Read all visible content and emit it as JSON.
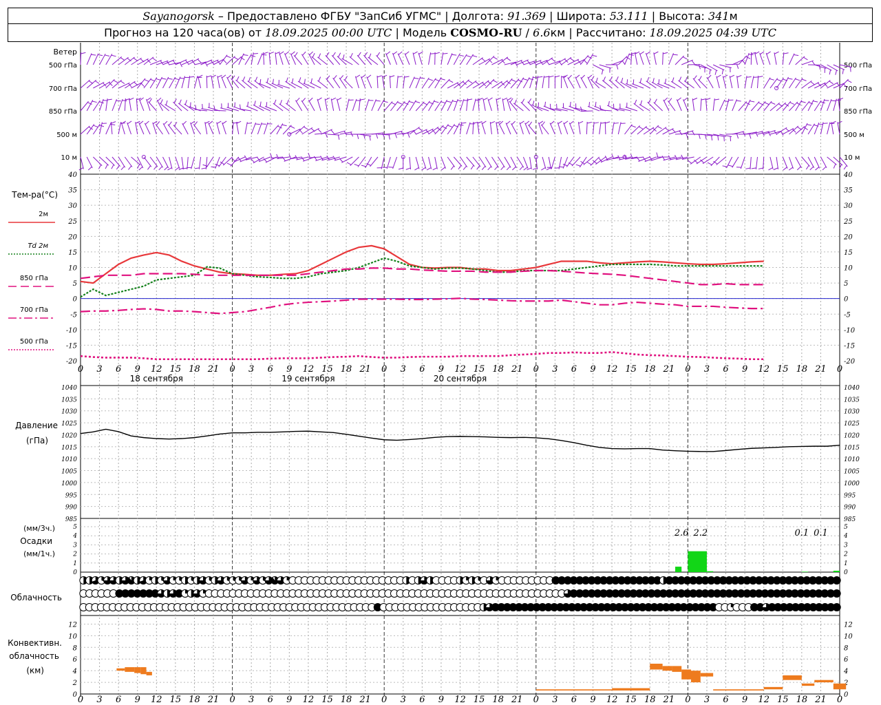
{
  "header": {
    "line1": [
      {
        "text": "Sayanogorsk",
        "style": "it"
      },
      {
        "text": " – Предоставлено ФГБУ \"ЗапСиб УГМС\" | Долгота: ",
        "style": ""
      },
      {
        "text": "91.369",
        "style": "it"
      },
      {
        "text": " | Широта: ",
        "style": ""
      },
      {
        "text": "53.111",
        "style": "it"
      },
      {
        "text": " | Высота: ",
        "style": ""
      },
      {
        "text": "341",
        "style": "it"
      },
      {
        "text": "м",
        "style": ""
      }
    ],
    "line2": [
      {
        "text": "Прогноз на 120 часа(ов) от ",
        "style": ""
      },
      {
        "text": "18.09.2025 00:00 UTC",
        "style": "it"
      },
      {
        "text": "  | Модель ",
        "style": ""
      },
      {
        "text": "COSMO-RU",
        "style": "bd"
      },
      {
        "text": " / ",
        "style": ""
      },
      {
        "text": "6.6",
        "style": "it"
      },
      {
        "text": "км | Рассчитано: ",
        "style": ""
      },
      {
        "text": "18.09.2025 04:39 UTC",
        "style": "it"
      }
    ]
  },
  "colors": {
    "t2m": "#e8373a",
    "td2m": "#13801a",
    "t850": "#e0107e",
    "t700": "#e0107e",
    "t500": "#e0107e",
    "wind": "#8a19c8",
    "pressure": "#000000",
    "precip": "#12d617",
    "convective": "#ee7b1e",
    "zeroline": "#2222cc"
  },
  "chart_data": [
    {
      "type": "barbs",
      "name": "wind",
      "panel_label": "Ветер",
      "levels": [
        "500 гПа",
        "700 гПа",
        "850 гПа",
        "500 м",
        "10 м"
      ],
      "x_hours": [
        0,
        120
      ],
      "time_step_h": 1
    },
    {
      "type": "line",
      "panel_label": "Тем-ра(°C)",
      "ylim": [
        -20,
        40
      ],
      "yticks": [
        -20,
        -15,
        -10,
        -5,
        0,
        5,
        10,
        15,
        20,
        25,
        30,
        35,
        40
      ],
      "legend": [
        {
          "label": "2м",
          "key": "t2m",
          "dash": "solid"
        },
        {
          "label": "Td  2м",
          "key": "td2m",
          "dash": "dot"
        },
        {
          "label": "850 гПа",
          "key": "t850",
          "dash": "long"
        },
        {
          "label": "700 гПа",
          "key": "t700",
          "dash": "dashdot"
        },
        {
          "label": "500 гПа",
          "key": "t500",
          "dash": "dot"
        }
      ],
      "x_hours": [
        0,
        2,
        4,
        6,
        8,
        10,
        12,
        14,
        16,
        18,
        20,
        22,
        24,
        26,
        28,
        30,
        32,
        34,
        36,
        38,
        40,
        42,
        44,
        46,
        48,
        50,
        52,
        54,
        56,
        58,
        60,
        62,
        64,
        66,
        68,
        70,
        72,
        74,
        76,
        78,
        80,
        82,
        84,
        86,
        88,
        90,
        92,
        94,
        96,
        98,
        100,
        102,
        104,
        106,
        108,
        110,
        112,
        114,
        116,
        118,
        120
      ],
      "series": [
        {
          "key": "t2m",
          "values": [
            5.5,
            5,
            8,
            11,
            13,
            14,
            14.8,
            14,
            12,
            10.5,
            9.5,
            8.5,
            8,
            7.8,
            7.5,
            7.5,
            7.8,
            8,
            9,
            11,
            13,
            15,
            16.5,
            17,
            16,
            13.5,
            11,
            10,
            9.8,
            10,
            10,
            9.5,
            9.5,
            9,
            9,
            9.5,
            10,
            11,
            12,
            12,
            12,
            11.5,
            11.2,
            11.5,
            11.8,
            12,
            11.8,
            11.5,
            11.2,
            11,
            11,
            11.2,
            11.5,
            11.8,
            12
          ]
        },
        {
          "key": "td2m",
          "values": [
            0.5,
            3,
            1,
            2,
            3,
            4,
            6,
            6.5,
            7,
            7.5,
            10.2,
            9.8,
            8,
            7.5,
            7,
            6.8,
            6.5,
            6.5,
            7,
            8,
            8.5,
            9,
            10,
            11.5,
            13,
            12,
            10.5,
            10,
            9.5,
            9.8,
            9.8,
            9.5,
            9,
            8.5,
            8.5,
            9,
            9,
            9,
            9,
            9.5,
            10,
            10.5,
            11,
            11,
            11,
            11,
            10.8,
            10.5,
            10.5,
            10.5,
            10.5,
            10.5,
            10.5,
            10.5,
            10.5
          ]
        },
        {
          "key": "t850",
          "values": [
            6.5,
            7,
            7.5,
            7.5,
            7.5,
            8,
            8,
            8,
            8,
            7.8,
            7.5,
            7.5,
            7.5,
            7.5,
            7.5,
            7.5,
            7.5,
            7.5,
            8,
            8.5,
            9,
            9.5,
            9.5,
            9.8,
            9.8,
            9.5,
            9.5,
            9.2,
            9,
            8.8,
            8.8,
            8.8,
            8.5,
            8.5,
            8.5,
            8.8,
            9,
            9,
            8.8,
            8.5,
            8.2,
            8,
            7.8,
            7.5,
            7,
            6.5,
            6,
            5.5,
            5,
            4.5,
            4.5,
            4.8,
            4.5,
            4.5,
            4.5
          ]
        },
        {
          "key": "t700",
          "values": [
            -4.2,
            -4,
            -4,
            -3.8,
            -3.5,
            -3.3,
            -3.5,
            -4,
            -4,
            -4.2,
            -4.5,
            -4.8,
            -4.5,
            -4.2,
            -3.5,
            -2.8,
            -2,
            -1.5,
            -1.2,
            -1,
            -0.8,
            -0.5,
            -0.2,
            -0.2,
            -0.2,
            -0.2,
            -0.3,
            -0.3,
            -0.2,
            -0.1,
            0.1,
            -0.2,
            -0.3,
            -0.5,
            -0.7,
            -0.8,
            -0.8,
            -0.8,
            -0.5,
            -1,
            -1.5,
            -2,
            -2,
            -1.5,
            -1.2,
            -1.5,
            -1.8,
            -2,
            -2.5,
            -2.5,
            -2.5,
            -2.8,
            -3,
            -3.2,
            -3.2
          ]
        },
        {
          "key": "t500",
          "values": [
            -18.5,
            -18.8,
            -19,
            -19,
            -19,
            -19.2,
            -19.5,
            -19.5,
            -19.5,
            -19.5,
            -19.5,
            -19.5,
            -19.5,
            -19.5,
            -19.5,
            -19.3,
            -19.2,
            -19.2,
            -19.2,
            -19,
            -18.8,
            -18.7,
            -18.5,
            -18.8,
            -19,
            -19,
            -18.8,
            -18.7,
            -18.7,
            -18.7,
            -18.5,
            -18.5,
            -18.5,
            -18.5,
            -18.2,
            -18,
            -17.8,
            -17.5,
            -17.5,
            -17.3,
            -17.5,
            -17.5,
            -17.2,
            -17.6,
            -18,
            -18.2,
            -18.3,
            -18.5,
            -18.7,
            -18.8,
            -19,
            -19.2,
            -19.3,
            -19.5,
            -19.5
          ]
        }
      ]
    },
    {
      "type": "line",
      "panel_label": "Давление",
      "panel_label2": "(гПа)",
      "ylim": [
        985,
        1040
      ],
      "yticks": [
        985,
        990,
        995,
        1000,
        1005,
        1010,
        1015,
        1020,
        1025,
        1030,
        1035,
        1040
      ],
      "x_hours": [
        0,
        2,
        4,
        6,
        8,
        10,
        12,
        14,
        16,
        18,
        20,
        22,
        24,
        26,
        28,
        30,
        32,
        34,
        36,
        38,
        40,
        42,
        44,
        46,
        48,
        50,
        52,
        54,
        56,
        58,
        60,
        62,
        64,
        66,
        68,
        70,
        72,
        74,
        76,
        78,
        80,
        82,
        84,
        86,
        88,
        90,
        92,
        94,
        96,
        98,
        100,
        102,
        104,
        106,
        108,
        110,
        112,
        114,
        116,
        118,
        120
      ],
      "series": [
        {
          "key": "pressure",
          "values": [
            1020.5,
            1021.2,
            1022.3,
            1021.3,
            1019.5,
            1018.8,
            1018.4,
            1018.2,
            1018.4,
            1018.8,
            1019.5,
            1020.3,
            1020.8,
            1020.8,
            1021.0,
            1021.0,
            1021.2,
            1021.4,
            1021.5,
            1021.2,
            1020.9,
            1020.2,
            1019.4,
            1018.6,
            1017.9,
            1017.7,
            1018.0,
            1018.4,
            1018.9,
            1019.2,
            1019.3,
            1019.2,
            1019.1,
            1018.9,
            1018.8,
            1018.9,
            1018.7,
            1018.3,
            1017.6,
            1016.7,
            1015.6,
            1014.7,
            1014.2,
            1014.1,
            1014.2,
            1014.2,
            1013.6,
            1013.3,
            1013.1,
            1013.0,
            1013.0,
            1013.4,
            1013.9,
            1014.3,
            1014.5,
            1014.7,
            1015.0,
            1015.1,
            1015.2,
            1015.2,
            1015.6
          ]
        }
      ]
    },
    {
      "type": "bar",
      "panel_label": "Осадки",
      "units_3h": "(мм/3ч.)",
      "units_1h": "(мм/1ч.)",
      "ylim": [
        0,
        5
      ],
      "yticks": [
        0,
        1,
        2,
        3,
        4,
        5
      ],
      "bars": [
        {
          "h": 94,
          "w": 1,
          "v": 0.6
        },
        {
          "h": 96,
          "w": 3,
          "v": 2.3
        },
        {
          "h": 99,
          "w": 1,
          "v": 0.1
        },
        {
          "h": 114,
          "w": 1,
          "v": 0.05
        },
        {
          "h": 119,
          "w": 1,
          "v": 0.15
        }
      ],
      "totals_3h": [
        {
          "h": 95,
          "label": "2.6"
        },
        {
          "h": 98,
          "label": "2.2"
        },
        {
          "h": 114,
          "label": "0.1"
        },
        {
          "h": 117,
          "label": "0.1"
        }
      ]
    },
    {
      "type": "table",
      "panel_label": "Облачность",
      "rows_fraction": [
        "0.5,0.5,0.7,0.3,0.75,0.75,0.5,0.75,0.9,0.5,0.7,0.25,0.5,0.3,0.75,0.25,0.3,0.5,0.3,0.5,0.75,0.3,0.5,0.75,0.3,0.3,0.3,0.75,0.25,0.75,0.3,0.75,0.9,0.75,0.25,0,0,0,0,0,0,0,0,0,0,0,0,0,0,0,0,0,0,0,0.5,0,0.5,0.75,0.5,0,0,0,0,0.5,0.25,0.5,0.3,0,0.75,0.25,0,0,0,0,0,0,0,0,0,1,1,1,1,1,1,1,1,1,1,1,1,1,1,1,1,1,1,0.5,1,1,1,1,1,1,1,1,1,1,1,1,1,1,1,1,1,1,1,1,1,1,1,1,1,1,1,1,1",
        "0,0,0,0,0,0,1,1,1,1,1,1,1,0.75,0.5,0.75,1,0.25,0.5,0.75,0.25,0,0,0,0,0,0,0,0,0,0,0,0,0,0,0,0,0,0,0,0,0,0,0,0,0,0,0,0,0,0,0,0,0,0,0,0,0,0,0,0,0,0,0,0,0,0,0,0,0,0,0,0,0,0,0,0,0,0,0,0,0.75,1,1,1,1,1,1,1,1,1,1,1,1,1,1,1,1,1,1,1,1,1,1,1,1,1,1,1,1,1,1,1,1,1,1,1,1,1,1,1,1,1,1,1,1,1",
        "0,0,0,0,0,0,0,0,0,0,0,0,0,0,0,0,0,0,0,0,0,0,0,0,0,0,0,0,0,0,0,0,0,0,0,0,0,0,0,0,0,0,0,0,0,0,0,0,0,0,1,0,0,0,0,0,0,0,0,0,0,0,0,0,0,0,0,0,0.5,0.75,1,1,1,1,1,1,1,1,1,1,1,1,1,1,1,1,1,1,1,1,1,1,1,1,1,1,1,1,1,1,1,1,1,1,1,1,1,1,0,0,0.25,0,0,0,1,1,0.75,1,1,1,1,1,1,1,1,1,1,1,1"
      ]
    },
    {
      "type": "bar",
      "panel_label": "Конвективн.",
      "panel_label2": "облачность",
      "panel_label3": "(км)",
      "ylim": [
        0,
        13
      ],
      "yticks": [
        0,
        2,
        4,
        6,
        8,
        10,
        12
      ],
      "boxes": [
        {
          "h0": 5.7,
          "h1": 7,
          "b": 4,
          "t": 4.4
        },
        {
          "h0": 7,
          "h1": 8.5,
          "b": 3.8,
          "t": 4.6
        },
        {
          "h0": 8.5,
          "h1": 9.5,
          "b": 3.6,
          "t": 4.6
        },
        {
          "h0": 9.5,
          "h1": 10.4,
          "b": 3.4,
          "t": 4.6
        },
        {
          "h0": 10.4,
          "h1": 11.3,
          "b": 3.2,
          "t": 3.8
        },
        {
          "h0": 72,
          "h1": 84,
          "b": 0.6,
          "t": 0.8
        },
        {
          "h0": 84,
          "h1": 90,
          "b": 0.6,
          "t": 1
        },
        {
          "h0": 90,
          "h1": 92,
          "b": 4.2,
          "t": 5.2
        },
        {
          "h0": 92,
          "h1": 93.5,
          "b": 4,
          "t": 4.8
        },
        {
          "h0": 93.5,
          "h1": 95,
          "b": 3.8,
          "t": 4.8
        },
        {
          "h0": 95,
          "h1": 96.5,
          "b": 2.5,
          "t": 4.2
        },
        {
          "h0": 96.5,
          "h1": 98,
          "b": 2,
          "t": 4
        },
        {
          "h0": 98,
          "h1": 100,
          "b": 3,
          "t": 3.6
        },
        {
          "h0": 100,
          "h1": 108,
          "b": 0.6,
          "t": 0.8
        },
        {
          "h0": 108,
          "h1": 111,
          "b": 0.8,
          "t": 1.2
        },
        {
          "h0": 111,
          "h1": 114,
          "b": 2.4,
          "t": 3.2
        },
        {
          "h0": 114,
          "h1": 116,
          "b": 1.4,
          "t": 1.8
        },
        {
          "h0": 116,
          "h1": 119,
          "b": 2,
          "t": 2.4
        },
        {
          "h0": 119,
          "h1": 121,
          "b": 0.8,
          "t": 1.8
        }
      ]
    }
  ],
  "x_axis": {
    "hour_labels": [
      "0",
      "3",
      "6",
      "9",
      "12",
      "15",
      "18",
      "21"
    ],
    "day_labels": [
      "18 сентября",
      "19 сентября",
      "20 сентября"
    ]
  }
}
